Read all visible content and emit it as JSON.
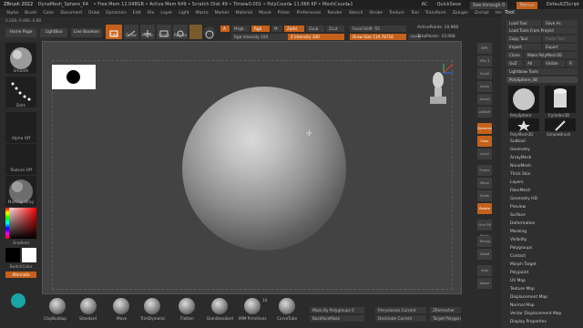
{
  "title_bar": {
    "app": "ZBrush 2022",
    "doc": "DynaMesh_Sphere_64",
    "stats": "• Free Mem 12.048GB • Active Mem 649 • Scratch Disk 49 • Timer▸0.001 • PolyCount▸ 11.066 KP • MeshCount▸1",
    "ac": "AC",
    "quicksave": "QuickSave",
    "seethrough": "See-through  0",
    "menus": "Menus",
    "script": "DefaultZScript"
  },
  "menubar": [
    "Alpha",
    "Brush",
    "Color",
    "Document",
    "Draw",
    "Dynamics",
    "Edit",
    "File",
    "Layer",
    "Light",
    "Macro",
    "Marker",
    "Material",
    "Movie",
    "Picker",
    "Preferences",
    "Render",
    "Stencil",
    "Stroke",
    "Texture",
    "Tool",
    "Transform",
    "Zplugin",
    "Zscript",
    "Help"
  ],
  "status_readout": "0.208,-0.486,-0.88",
  "shelf": {
    "home": "Home Page",
    "lightbox": "LightBox",
    "livebool": "Live Boolean",
    "edit": "Edit",
    "draw": "Draw",
    "move": "Move",
    "scale": "Scale",
    "rotate": "Rotate",
    "a_label": "A",
    "mrgb": "Mrgb",
    "rgb": "Rgb",
    "m": "M",
    "zadd": "Zadd",
    "zsub": "Zsub",
    "zcut": "Zcut",
    "rgb_intensity": "Rgb Intensity 100",
    "z_intensity": "Z Intensity 100",
    "focal_shift": "Focal Shift -55",
    "draw_size": "Draw Size 119.78716",
    "dynamic": "Dynamic",
    "active_points": "ActivePoints: 10,968",
    "total_points": "TotalPoints: 10,968"
  },
  "left_shelf": {
    "items": [
      "Smooth",
      "Dots",
      "Alpha Off",
      "Texture Off",
      "MatCap Gray"
    ],
    "gradient": "Gradient",
    "switchcolor": "SwitchColor",
    "alternate": "Alternate"
  },
  "right_strip": [
    "BPR",
    "SPix 3",
    "Scroll",
    "Zoom",
    "Actual",
    "AAHalf",
    "Dynamic Persp",
    "Floor",
    "Local",
    "Frame",
    "Move",
    "Scale",
    "Rotate",
    "Line Fill PolyF",
    "Transp",
    "Ghost",
    "Solo",
    "Xpose"
  ],
  "tool_panel": {
    "header": "Tool",
    "load_tool": "Load Tool",
    "save_as": "Save As",
    "load_from_project": "Load Tools From Project",
    "copy_tool": "Copy Tool",
    "paste_tool": "Paste Tool",
    "import": "Import",
    "export": "Export",
    "clone": "Clone",
    "make_polymesh": "Make PolyMesh3D",
    "goz": "GoZ",
    "all": "All",
    "visible": "Visible",
    "r": "R",
    "lightbox_tools": "Lightbox▸ Tools",
    "current_tool": "PolySphere_48",
    "thumbs": [
      "PolySphere",
      "Cylinder3D",
      "PolyMesh3D",
      "SimpleBrush"
    ],
    "subpalettes": [
      "Subtool",
      "Geometry",
      "ArrayMesh",
      "NanoMesh",
      "Thick Skin",
      "Layers",
      "FiberMesh",
      "Geometry HD",
      "Preview",
      "Surface",
      "Deformation",
      "Masking",
      "Visibility",
      "Polygroups",
      "Contact",
      "Morph Target",
      "Polypaint",
      "UV Map",
      "Texture Map",
      "Displacement Map",
      "Normal Map",
      "Vector Displacement Map",
      "Display Properties"
    ]
  },
  "bottom_shelf": {
    "brushes": [
      "ClayBuildup",
      "Standard",
      "Move",
      "TrimDynamic",
      "Flatten",
      "DamStandard",
      "IMM Primitives",
      "CurveTube"
    ],
    "imm_count": "14",
    "mask_by_polygroups": "Mask By Polygroups 0",
    "backface_mask": "BackfaceMask",
    "preprocess": "Pre-process Current",
    "decimate": "Decimate Current",
    "zremesher": "ZRemesher",
    "target_count": "Target Polygons Count 5",
    "weld": "Weld",
    "shell": "Shell"
  },
  "colors": {
    "accent": "#c5611a",
    "panel": "#2b2b2b",
    "canvas": "#434343",
    "pane_dark": "#1f1f1f"
  }
}
